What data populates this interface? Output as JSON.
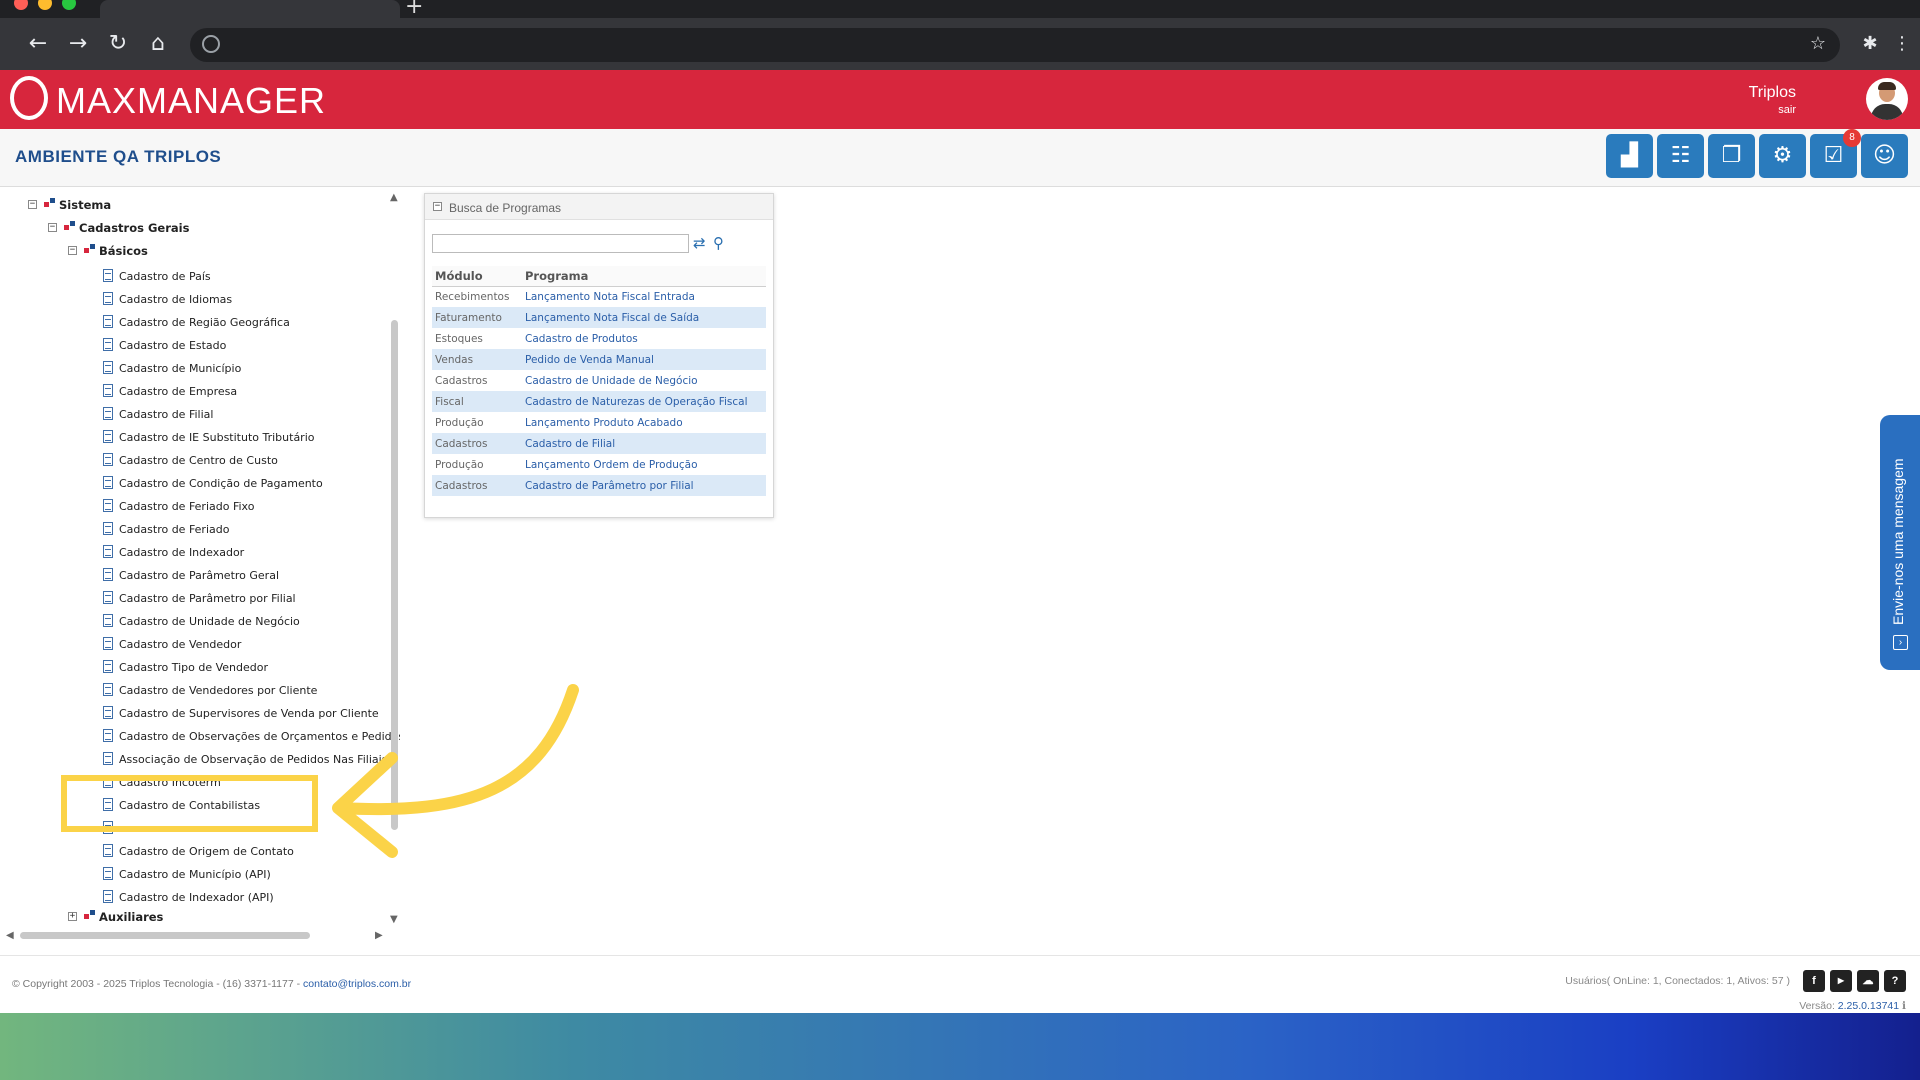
{
  "app": {
    "logo_text": "MAXMANAGER",
    "user_name": "Triplos",
    "logout_label": "sair",
    "environment_title": "AMBIENTE QA TRIPLOS",
    "notification_count": "8",
    "brand_color": "#d7263d",
    "accent_color": "#2a7bbd"
  },
  "toolbar_icons": [
    "reports-icon",
    "network-icon",
    "documents-icon",
    "settings-icon",
    "tasks-icon",
    "user-support-icon"
  ],
  "tree": {
    "root": "Sistema",
    "group": "Cadastros Gerais",
    "subgroup": "Básicos",
    "items": [
      "Cadastro de País",
      "Cadastro de Idiomas",
      "Cadastro de Região Geográfica",
      "Cadastro de Estado",
      "Cadastro de Município",
      "Cadastro de Empresa",
      "Cadastro de Filial",
      "Cadastro de IE Substituto Tributário",
      "Cadastro de Centro de Custo",
      "Cadastro de Condição de Pagamento",
      "Cadastro de Feriado Fixo",
      "Cadastro de Feriado",
      "Cadastro de Indexador",
      "Cadastro de Parâmetro Geral",
      "Cadastro de Parâmetro por Filial",
      "Cadastro de Unidade de Negócio",
      "Cadastro de Vendedor",
      "Cadastro Tipo de Vendedor",
      "Cadastro de Vendedores por Cliente",
      "Cadastro de Supervisores de Venda por Cliente",
      "Cadastro de Observações de Orçamentos e Pedidos de",
      "Associação de Observação de Pedidos Nas Filiais",
      "Cadastro Incoterm",
      "Cadastro de Contabilistas",
      "",
      "Cadastro de Origem de Contato",
      "Cadastro de Município (API)",
      "Cadastro de Indexador (API)"
    ],
    "auxiliares": "Auxiliares"
  },
  "busca": {
    "title": "Busca de Programas",
    "search_value": "",
    "col_modulo": "Módulo",
    "col_programa": "Programa",
    "rows": [
      {
        "modulo": "Recebimentos",
        "programa": "Lançamento Nota Fiscal Entrada"
      },
      {
        "modulo": "Faturamento",
        "programa": "Lançamento Nota Fiscal de Saída"
      },
      {
        "modulo": "Estoques",
        "programa": "Cadastro de Produtos"
      },
      {
        "modulo": "Vendas",
        "programa": "Pedido de Venda Manual"
      },
      {
        "modulo": "Cadastros",
        "programa": "Cadastro de Unidade de Negócio"
      },
      {
        "modulo": "Fiscal",
        "programa": "Cadastro de Naturezas de Operação Fiscal"
      },
      {
        "modulo": "Produção",
        "programa": "Lançamento Produto Acabado"
      },
      {
        "modulo": "Cadastros",
        "programa": "Cadastro de Filial"
      },
      {
        "modulo": "Produção",
        "programa": "Lançamento Ordem de Produção"
      },
      {
        "modulo": "Cadastros",
        "programa": "Cadastro de Parâmetro por Filial"
      }
    ]
  },
  "feedback_tab": "Envie-nos uma mensagem",
  "footer": {
    "copyright": "© Copyright 2003 - 2025 Triplos Tecnologia - (16) 3371-1177 - ",
    "email": "contato@triplos.com.br",
    "users_info": "Usuários( OnLine: 1, Conectados: 1, Ativos: 57 )",
    "version_label": "Versão: ",
    "version_value": "2.25.0.13741"
  },
  "annotation": {
    "highlight_color": "#fbd348",
    "highlighted_item": "Cadastro de Contabilistas"
  }
}
